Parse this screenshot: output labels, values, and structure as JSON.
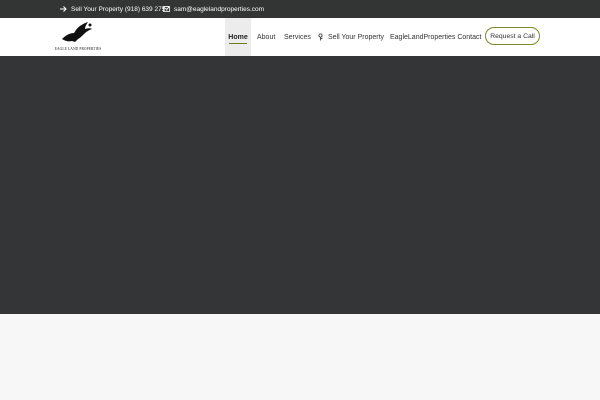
{
  "topbar": {
    "phone_text": "Sell Your Property (918) 639 2757",
    "email_text": "sam@eaglelandproperties.com",
    "icons": [
      "arrow-right-icon",
      "envelope-icon"
    ]
  },
  "logo": {
    "text": "EAGLE LAND PROPERTIES",
    "icon": "eagle-icon"
  },
  "nav": {
    "items": [
      {
        "label": "Home",
        "active": true
      },
      {
        "label": "About"
      },
      {
        "label": "Services"
      },
      {
        "label": "Sell Your Property",
        "icon": "flower-icon"
      },
      {
        "label": "EagleLandProperties Contact"
      }
    ],
    "cta_label": "Request a Call"
  },
  "colors": {
    "topbar_bg": "#333535",
    "hero_bg": "#333536",
    "accent": "#7a8a2a",
    "page_bg": "#f7f7f7"
  }
}
